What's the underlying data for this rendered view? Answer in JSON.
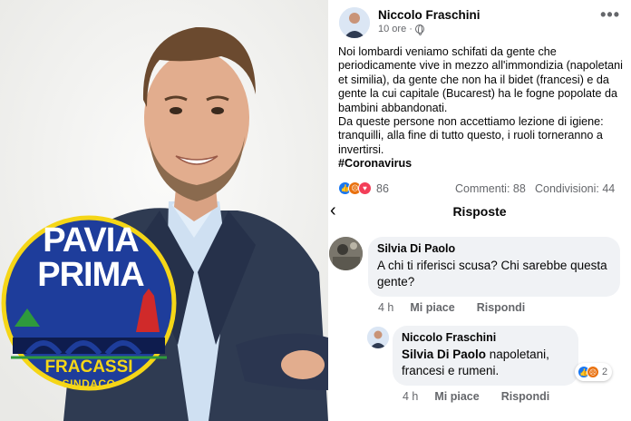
{
  "logo": {
    "line1": "PAVIA",
    "line2": "PRIMA",
    "candidate": "FRACASSI",
    "role": "SINDACO",
    "colors": {
      "badge": "#1e3d9b",
      "accent": "#f5d617",
      "green": "#2e9a3c",
      "red": "#d02a2a"
    }
  },
  "post": {
    "author": "Niccolo Fraschini",
    "time": "10 ore",
    "privacy_icon": "globe-icon",
    "more_icon": "more-options-icon",
    "paragraph1": "Noi lombardi veniamo schifati da gente che periodicamente vive in mezzo all'immondizia (napoletani et similia), da gente che non ha il bidet (francesi) e da gente la cui capitale (Bucarest) ha le fogne popolate da bambini abbandonati.",
    "paragraph2": "Da queste persone non accettiamo lezione di igiene: tranquilli, alla fine di tutto questo, i ruoli torneranno a invertirsi.",
    "hashtag": "#Coronavirus",
    "reaction_count": "86",
    "comments": "Commenti: 88",
    "shares": "Condivisioni: 44"
  },
  "replies_header": {
    "title": "Risposte",
    "back_icon": "back-arrow-icon"
  },
  "comment": {
    "author": "Silvia Di Paolo",
    "text": "A chi ti riferisci scusa? Chi sarebbe questa gente?",
    "time": "4 h",
    "like": "Mi piace",
    "reply": "Rispondi"
  },
  "reply": {
    "author": "Niccolo Fraschini",
    "mention": "Silvia Di Paolo",
    "text": " napoletani, francesi e rumeni.",
    "time": "4 h",
    "like": "Mi piace",
    "reply": "Rispondi",
    "reaction_count": "2"
  },
  "colors": {
    "link_blue": "#1877f2",
    "grey_text": "#65676b",
    "bubble": "#f0f2f5"
  }
}
